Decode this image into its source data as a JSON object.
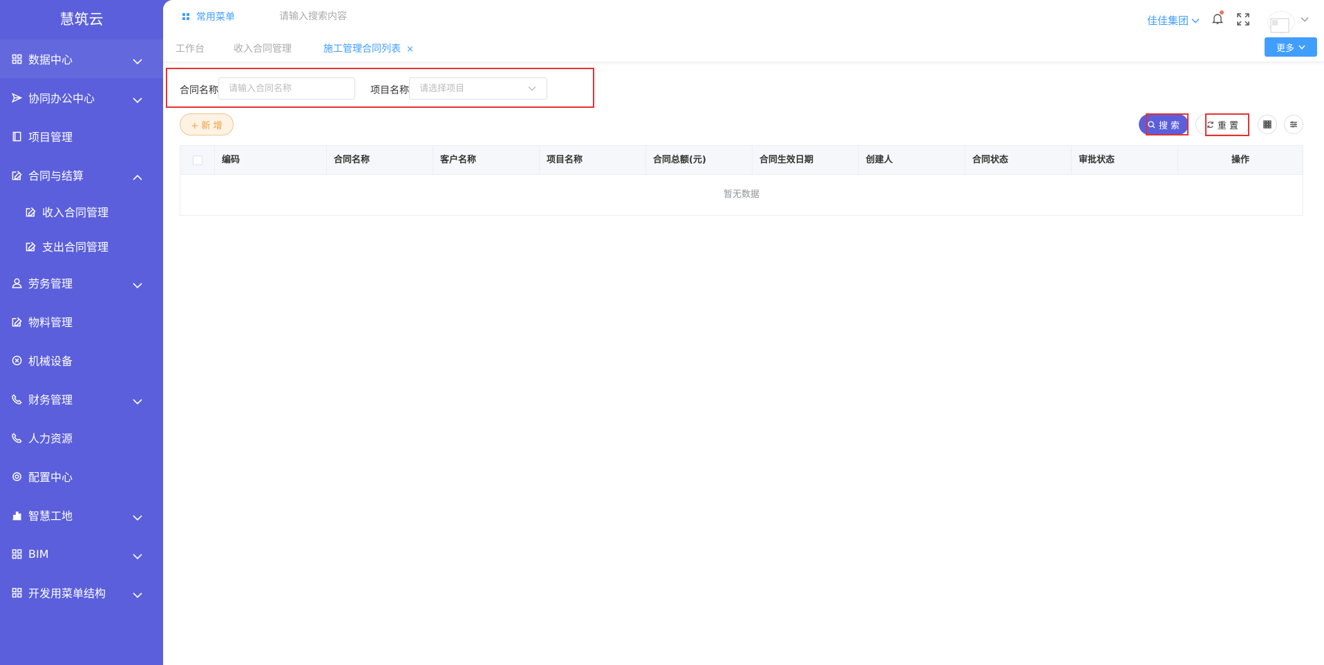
{
  "app": {
    "title": "慧筑云"
  },
  "sidebar": {
    "items": [
      {
        "label": "数据中心",
        "icon": "grid-icon",
        "expandable": true
      },
      {
        "label": "协同办公中心",
        "icon": "send-icon",
        "expandable": true
      },
      {
        "label": "项目管理",
        "icon": "book-icon",
        "expandable": false
      },
      {
        "label": "合同与结算",
        "icon": "edit-icon",
        "expandable": true,
        "expanded": true
      },
      {
        "label": "收入合同管理",
        "icon": "edit-icon",
        "sub": true
      },
      {
        "label": "支出合同管理",
        "icon": "edit-icon",
        "sub": true
      },
      {
        "label": "劳务管理",
        "icon": "user-icon",
        "expandable": true
      },
      {
        "label": "物料管理",
        "icon": "edit-icon",
        "expandable": false
      },
      {
        "label": "机械设备",
        "icon": "circle-x-icon",
        "expandable": false
      },
      {
        "label": "财务管理",
        "icon": "phone-icon",
        "expandable": true
      },
      {
        "label": "人力资源",
        "icon": "phone-icon",
        "expandable": false
      },
      {
        "label": "配置中心",
        "icon": "gear-icon",
        "expandable": false
      },
      {
        "label": "智慧工地",
        "icon": "bar-chart-icon",
        "expandable": true
      },
      {
        "label": "BIM",
        "icon": "grid-icon",
        "expandable": true
      },
      {
        "label": "开发用菜单结构",
        "icon": "grid-icon",
        "expandable": true
      }
    ]
  },
  "topbar": {
    "quick_menu": "常用菜单",
    "search_placeholder": "请输入搜索内容",
    "org_name": "佳佳集团"
  },
  "tabs": {
    "items": [
      {
        "label": "工作台"
      },
      {
        "label": "收入合同管理"
      },
      {
        "label": "施工管理合同列表",
        "active": true,
        "close": "×"
      }
    ],
    "more_label": "更多"
  },
  "form": {
    "contract_name_label": "合同名称",
    "contract_name_placeholder": "请输入合同名称",
    "project_name_label": "项目名称",
    "project_name_placeholder": "请选择项目"
  },
  "toolbar": {
    "add_label": "+ 新 增",
    "search_label": "搜 索",
    "reset_label": "重 置"
  },
  "table": {
    "columns": [
      "编码",
      "合同名称",
      "客户名称",
      "项目名称",
      "合同总额(元)",
      "合同生效日期",
      "创建人",
      "合同状态",
      "审批状态",
      "操作"
    ],
    "empty_text": "暂无数据"
  },
  "colors": {
    "sidebar_bg": "#5b5fdb",
    "accent": "#409eff",
    "highlight_border": "#e63030"
  }
}
